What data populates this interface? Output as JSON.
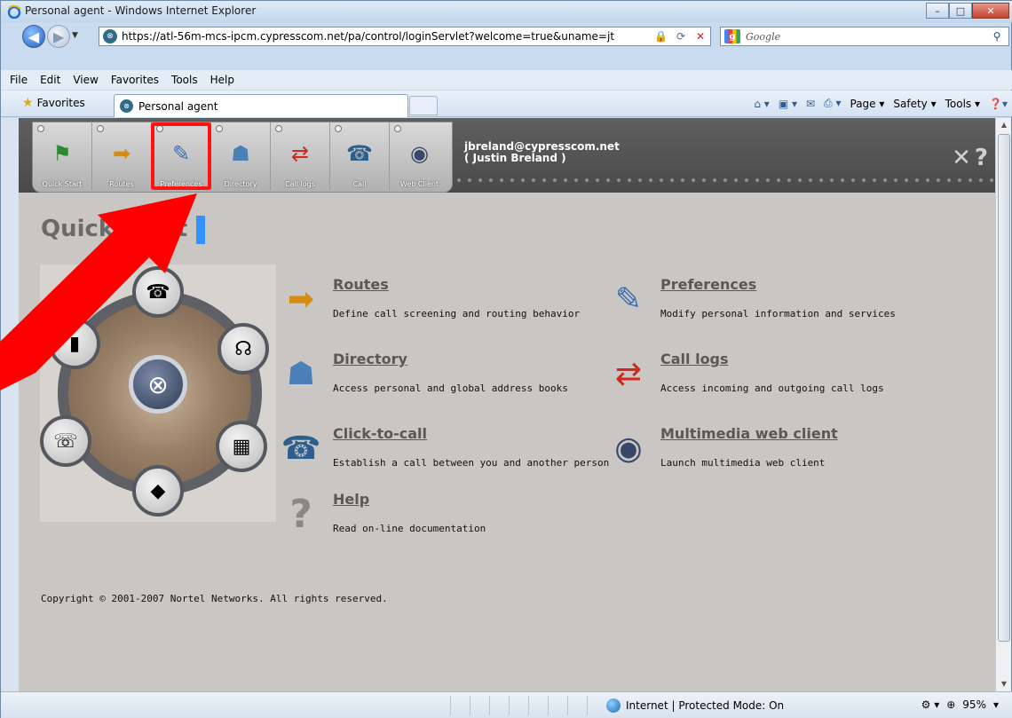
{
  "window": {
    "title": "Personal agent - Windows Internet Explorer",
    "minimize": "–",
    "maximize": "□",
    "close": "✕"
  },
  "address": {
    "url": "https://atl-56m-mcs-ipcm.cypresscom.net/pa/control/loginServlet?welcome=true&uname=jt",
    "search_placeholder": "Google"
  },
  "menu": [
    "File",
    "Edit",
    "View",
    "Favorites",
    "Tools",
    "Help"
  ],
  "favorites": {
    "label": "Favorites",
    "tab_title": "Personal agent",
    "commands": [
      "Page ▾",
      "Safety ▾",
      "Tools ▾"
    ]
  },
  "toolbar": {
    "items": [
      {
        "name": "quick-start",
        "label": "Quick Start",
        "icon": "⚑"
      },
      {
        "name": "routes",
        "label": "Routes",
        "icon": "➡"
      },
      {
        "name": "preferences",
        "label": "Preferences",
        "icon": "✎"
      },
      {
        "name": "directory",
        "label": "Directory",
        "icon": "☗"
      },
      {
        "name": "call-logs",
        "label": "Call logs",
        "icon": "⇄"
      },
      {
        "name": "call",
        "label": "Call",
        "icon": "☎"
      },
      {
        "name": "web-client",
        "label": "Web Client",
        "icon": "◉"
      }
    ]
  },
  "user": {
    "email": "jbreland@cypresscom.net",
    "name": "( Justin Breland )"
  },
  "page": {
    "heading": "Quick Start",
    "copyright": "Copyright © 2001-2007 Nortel Networks. All rights reserved."
  },
  "features": {
    "routes": {
      "title": "Routes",
      "desc": "Define call screening and routing behavior"
    },
    "preferences": {
      "title": "Preferences",
      "desc": "Modify personal information and services"
    },
    "directory": {
      "title": "Directory",
      "desc": "Access personal and global address books"
    },
    "call_logs": {
      "title": "Call logs",
      "desc": "Access incoming and outgoing call logs"
    },
    "click_to_call": {
      "title": "Click-to-call",
      "desc": "Establish a call between you and another person"
    },
    "web_client": {
      "title": "Multimedia web client",
      "desc": "Launch multimedia web client"
    },
    "help": {
      "title": "Help",
      "desc": "Read on-line documentation"
    }
  },
  "status": {
    "zone": "Internet | Protected Mode: On",
    "zoom": "95%"
  },
  "colors": {
    "highlight": "#ff1212",
    "arrow": "#ff0000",
    "page_bg": "#c9c6c3"
  }
}
